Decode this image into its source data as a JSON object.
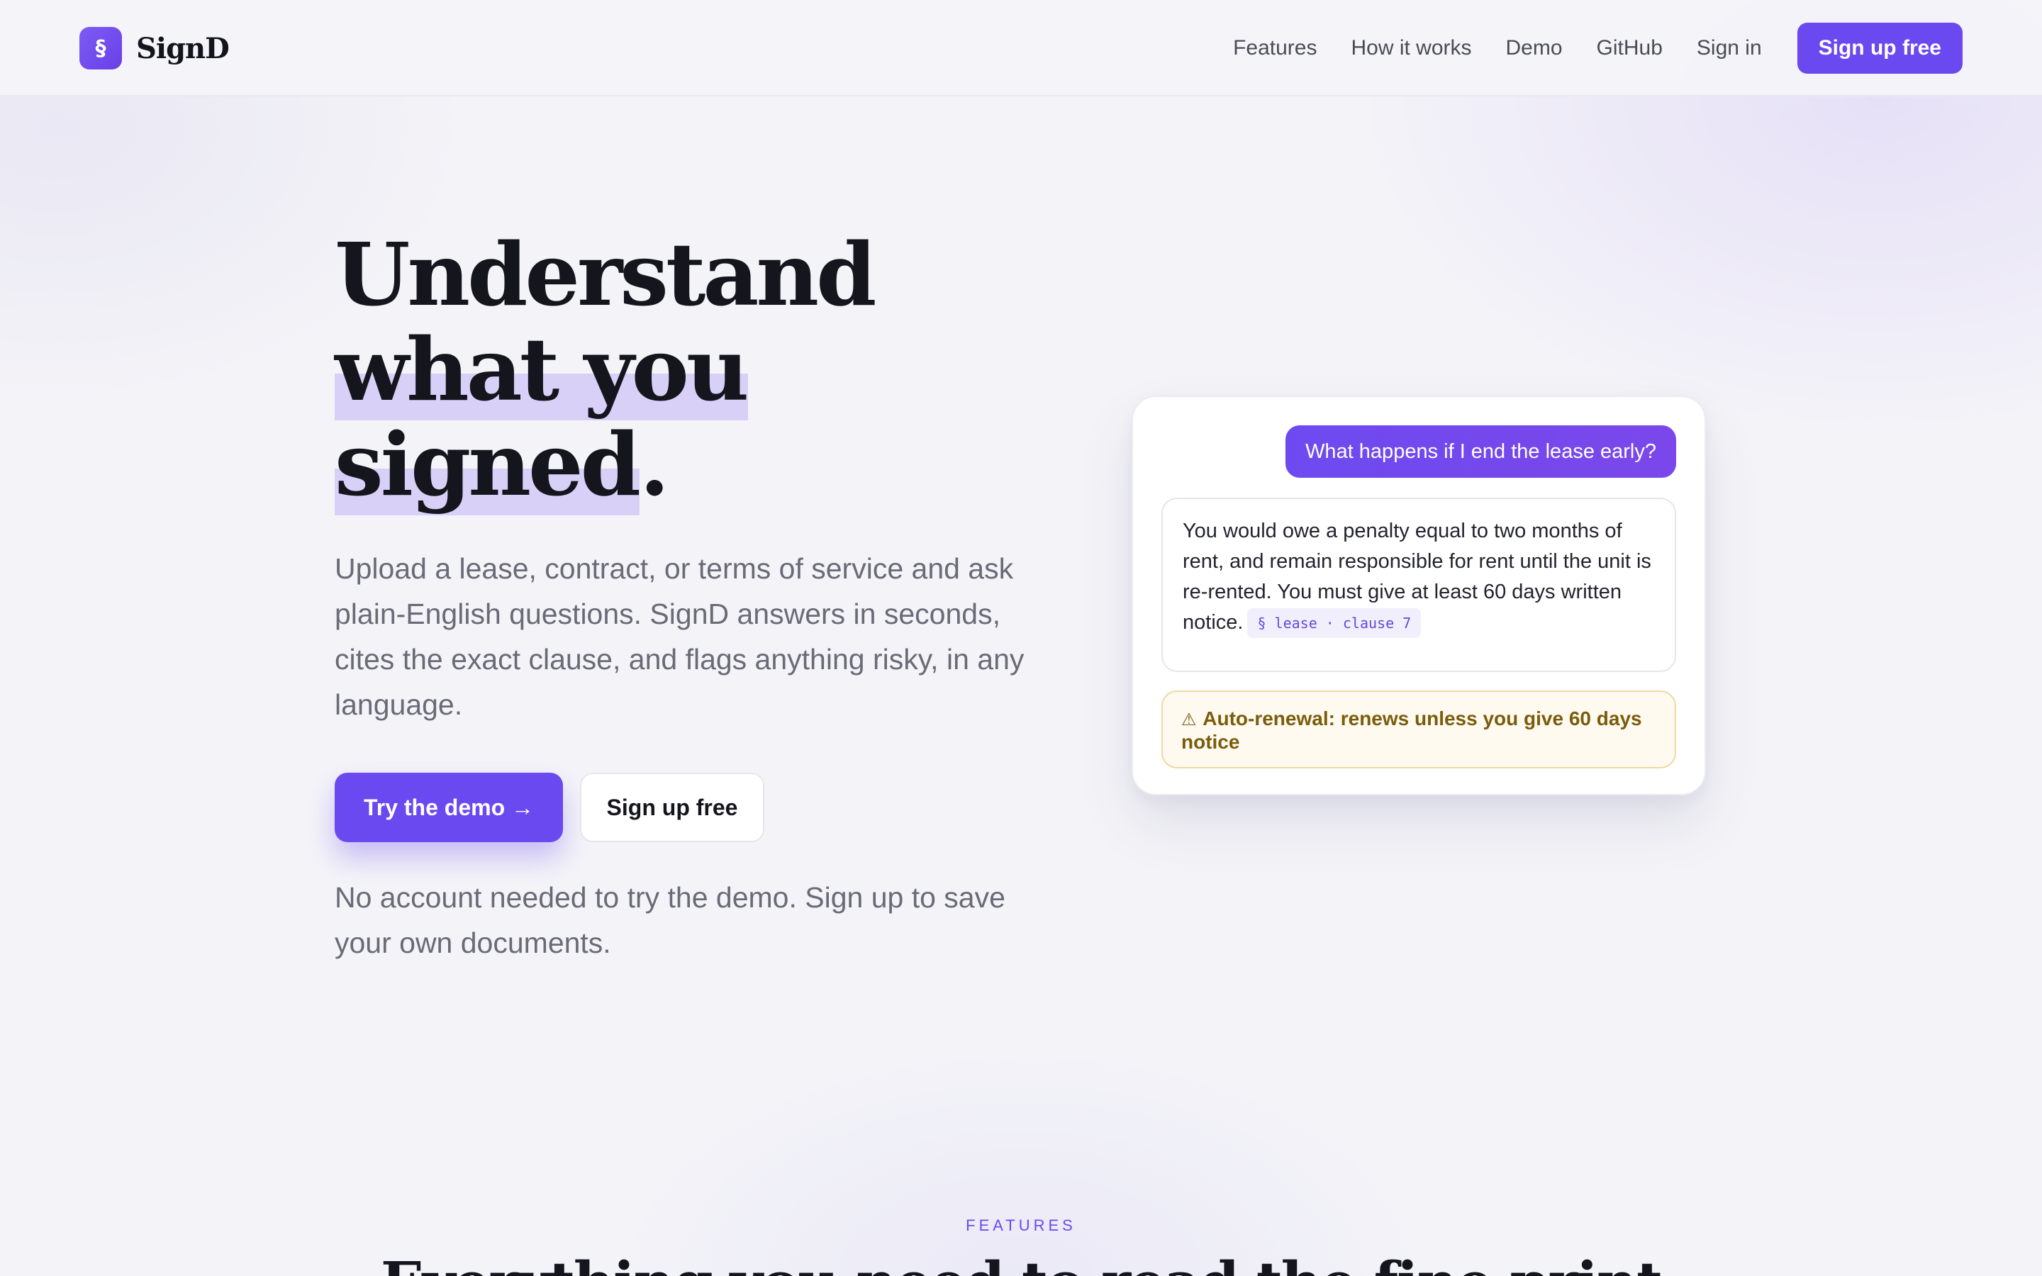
{
  "brand": {
    "logo_glyph": "§",
    "name": "SignD"
  },
  "nav": {
    "links": [
      "Features",
      "How it works",
      "Demo",
      "GitHub",
      "Sign in"
    ],
    "cta": "Sign up free"
  },
  "hero": {
    "title_line1": "Understand",
    "title_line2": "what you",
    "title_line3_highlight": "signed",
    "title_line3_tail": ".",
    "subtitle": "Upload a lease, contract, or terms of service and ask plain-English questions. SignD answers in seconds, cites the exact clause, and flags anything risky, in any language.",
    "primary_button": "Try the demo →",
    "secondary_button": "Sign up free",
    "note": "No account needed to try the demo. Sign up to save your own documents."
  },
  "chat": {
    "question": "What happens if I end the lease early?",
    "answer": "You would owe a penalty equal to two months of rent, and remain responsible for rent until the unit is re-rented. You must give at least 60 days written notice.",
    "citation": "§ lease · clause 7",
    "warning_icon": "⚠",
    "warning": "Auto-renewal: renews unless you give 60 days notice"
  },
  "features": {
    "eyebrow": "FEATURES",
    "title": "Everything you need to read the fine print"
  },
  "colors": {
    "accent": "#6b49f0",
    "highlight": "#d8d0f7",
    "warning_bg": "#fefaf0",
    "warning_text": "#7a5c0c"
  }
}
